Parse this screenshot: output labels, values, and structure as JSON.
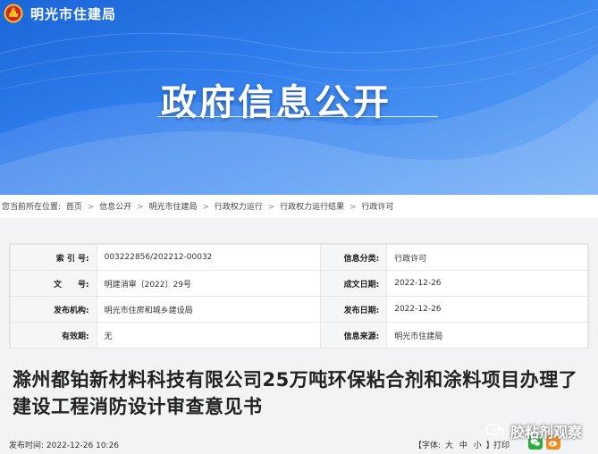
{
  "header": {
    "site_name": "明光市住建局",
    "banner_title": "政府信息公开"
  },
  "breadcrumb": {
    "prefix": "您当前所在位置:",
    "items": [
      "首页",
      "信息公开",
      "明光市住建局",
      "行政权力运行",
      "行政权力运行结果",
      "行政许可"
    ],
    "separator": ">"
  },
  "info": {
    "index_label": "索 引 号:",
    "index_value": "003222856/202212-00032",
    "category_label": "信息分类:",
    "category_value": "行政许可",
    "docno_label": "文　　号:",
    "docno_value": "明建消审〔2022〕29号",
    "created_label": "成文日期:",
    "created_value": "2022-12-26",
    "publisher_label": "发布机构:",
    "publisher_value": "明光市住房和城乡建设局",
    "pubdate_label": "发布日期:",
    "pubdate_value": "2022-12-26",
    "validity_label": "有效期:",
    "validity_value": "无",
    "source_label": "信息来源:",
    "source_value": "明光市住建局"
  },
  "document": {
    "title": "滁州都铂新材料科技有限公司25万吨环保粘合剂和涂料项目办理了建设工程消防设计审查意见书",
    "publish_time_label": "发布时间:",
    "publish_time": "2022-12-26 10:26"
  },
  "controls": {
    "font_label": "【字体:",
    "font_large": "大",
    "font_medium": "中",
    "font_small": "小",
    "font_close": "】",
    "print_label": "打印"
  },
  "watermark": {
    "text": "胶粘剂观察"
  },
  "colors": {
    "banner_primary": "#2e7bec",
    "banner_light": "#6aa8f5",
    "wechat_green": "#2aae3c",
    "weibo_orange": "#f58a1f",
    "emblem_red": "#d8232a",
    "emblem_gold": "#f4c21b"
  },
  "icons": [
    "national-emblem-icon",
    "wechat-icon",
    "wechat-share-icon",
    "weibo-share-icon"
  ]
}
